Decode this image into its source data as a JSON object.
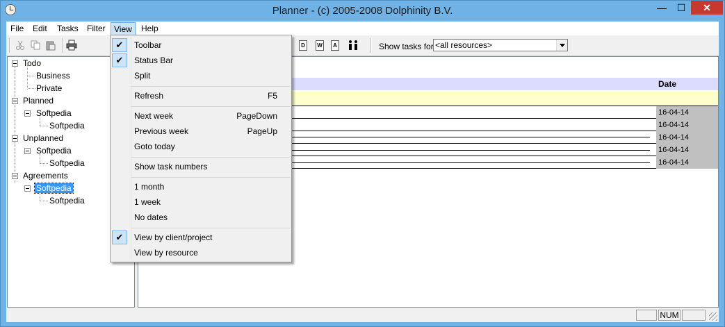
{
  "window": {
    "title": "Planner - (c) 2005-2008 Dolphinity B.V.",
    "min": "—",
    "max": "☐",
    "close": "✕"
  },
  "menubar": [
    "File",
    "Edit",
    "Tasks",
    "Filter",
    "View",
    "Help"
  ],
  "toolbar": {
    "show_tasks_label": "Show tasks for",
    "resource_select": "<all resources>"
  },
  "tree": {
    "todo": "Todo",
    "business": "Business",
    "private": "Private",
    "planned": "Planned",
    "planned_child": "Softpedia",
    "planned_leaf": "Softpedia",
    "unplanned": "Unplanned",
    "unplanned_child": "Softpedia",
    "unplanned_leaf": "Softpedia",
    "agreements": "Agreements",
    "agreements_child": "Softpedia",
    "agreements_leaf": "Softpedia"
  },
  "grid": {
    "date_header": "Date",
    "dates": [
      "16-04-14",
      "16-04-14",
      "16-04-14",
      "16-04-14",
      "16-04-14"
    ]
  },
  "view_menu": {
    "toolbar": "Toolbar",
    "status_bar": "Status Bar",
    "split": "Split",
    "refresh": "Refresh",
    "refresh_key": "F5",
    "next_week": "Next week",
    "next_week_key": "PageDown",
    "previous_week": "Previous week",
    "previous_week_key": "PageUp",
    "goto_today": "Goto today",
    "show_task_numbers": "Show task numbers",
    "one_month": "1 month",
    "one_week": "1 week",
    "no_dates": "No dates",
    "view_by_client": "View by client/project",
    "view_by_resource": "View by resource",
    "check": "✔"
  },
  "statusbar": {
    "num": "NUM"
  }
}
